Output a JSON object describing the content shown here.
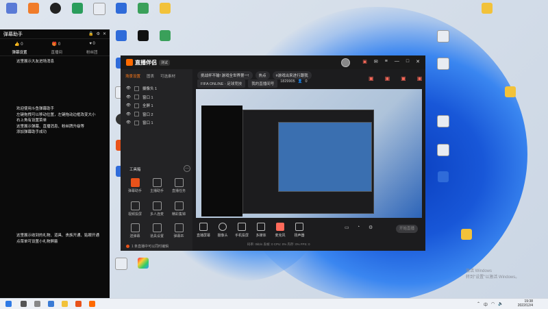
{
  "colors": {
    "accent": "#ff6a00",
    "panel_bg": "#0b0b0b",
    "window_bg": "#1c1c1e",
    "live_red": "#ff6a5a"
  },
  "danmaku_panel": {
    "title": "弹幕助手",
    "likes": [
      "0",
      "0",
      "0"
    ],
    "tabs": [
      "弹幕设置",
      "直播间",
      "粉丝团"
    ],
    "gift_text": "这里展示大友进场消息",
    "help_lines": [
      "欢迎使用斗鱼弹幕助手",
      "左键拖拽可以移动位置，左键拖动边框改变大小",
      "右上角有设置菜单",
      "这里展示弹幕、直播消息、粉丝牌升级等",
      "添加弹幕助手成功"
    ],
    "bottom_lines": [
      "这里展示收到的礼物、道具、贵族开通、贴眼开通",
      "点菜单可设置小礼物屏蔽"
    ]
  },
  "main_window": {
    "app_name": "直播伴侣",
    "version": "测试",
    "scene_tabs": [
      "场景设置",
      "图表",
      "可选素材"
    ],
    "layers": [
      "摄像头 1",
      "窗口 1",
      "全屏 1",
      "窗口 2",
      "窗口 1"
    ],
    "tools_title": "工具箱",
    "tools": [
      "弹幕助手",
      "主播助手",
      "直播任务",
      "视频投屏",
      "多人连麦",
      "精彩集锦",
      "送弹幕",
      "道具设置",
      "弹幕匹",
      "更多",
      "高清转播",
      "更多"
    ],
    "status_text": "1 条直播中可以同时编辑",
    "pills": [
      "挑战杯不输! 游戏全世界第一!",
      "热点",
      "#游戏出来进行跟我"
    ],
    "game": "FIFA ONLINE - 足球竞技",
    "room_label": "我的直播间号",
    "room_id": "1829905",
    "viewers": "0",
    "bottom_controls": [
      "直播屏幕",
      "摄像头",
      "手机投屏",
      "多媒体",
      "麦克风",
      "扬声器"
    ],
    "start_button": "开始直播",
    "stats": "码率: 0kb/s  丢帧: 0  CPU: 0%  内存: 0%  FPS: 0"
  },
  "taskbar": {
    "time": "19:38",
    "date": "2022/12/4"
  },
  "watermark": {
    "line1": "激活 Windows",
    "line2": "转到\"设置\"以激活 Windows。"
  }
}
